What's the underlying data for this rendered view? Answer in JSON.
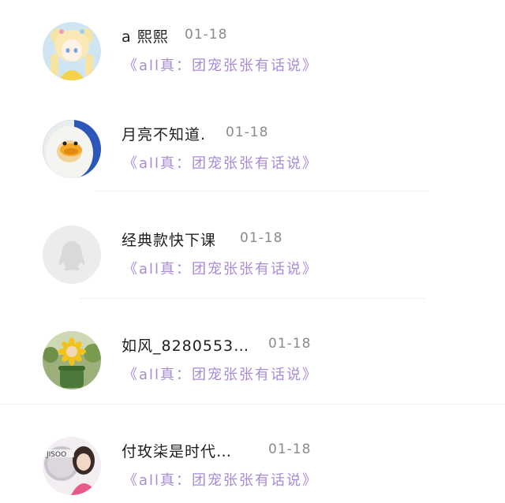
{
  "comments": [
    {
      "username": "a 熙熙",
      "date": "01-18",
      "post_ref": "《all真：团宠张张有话说》",
      "avatar_icon": "anime-girl-avatar"
    },
    {
      "username": "月亮不知道.",
      "date": "01-18",
      "post_ref": "《all真：团宠张张有话说》",
      "avatar_icon": "duck-costume-avatar"
    },
    {
      "username": "经典款快下课",
      "date": "01-18",
      "post_ref": "《all真：团宠张张有话说》",
      "avatar_icon": "default-penguin-avatar"
    },
    {
      "username": "如风_8280553…",
      "date": "01-18",
      "post_ref": "《all真：团宠张张有话说》",
      "avatar_icon": "sunflower-pot-avatar"
    },
    {
      "username": "付玫柒是时代…",
      "date": "01-18",
      "post_ref": "《all真：团宠张张有话说》",
      "avatar_icon": "jisoo-photo-avatar"
    }
  ],
  "colors": {
    "username": "#1f1f1f",
    "date": "#8a8a8a",
    "post_ref": "#a98ad6",
    "divider": "#f1f1f4"
  }
}
